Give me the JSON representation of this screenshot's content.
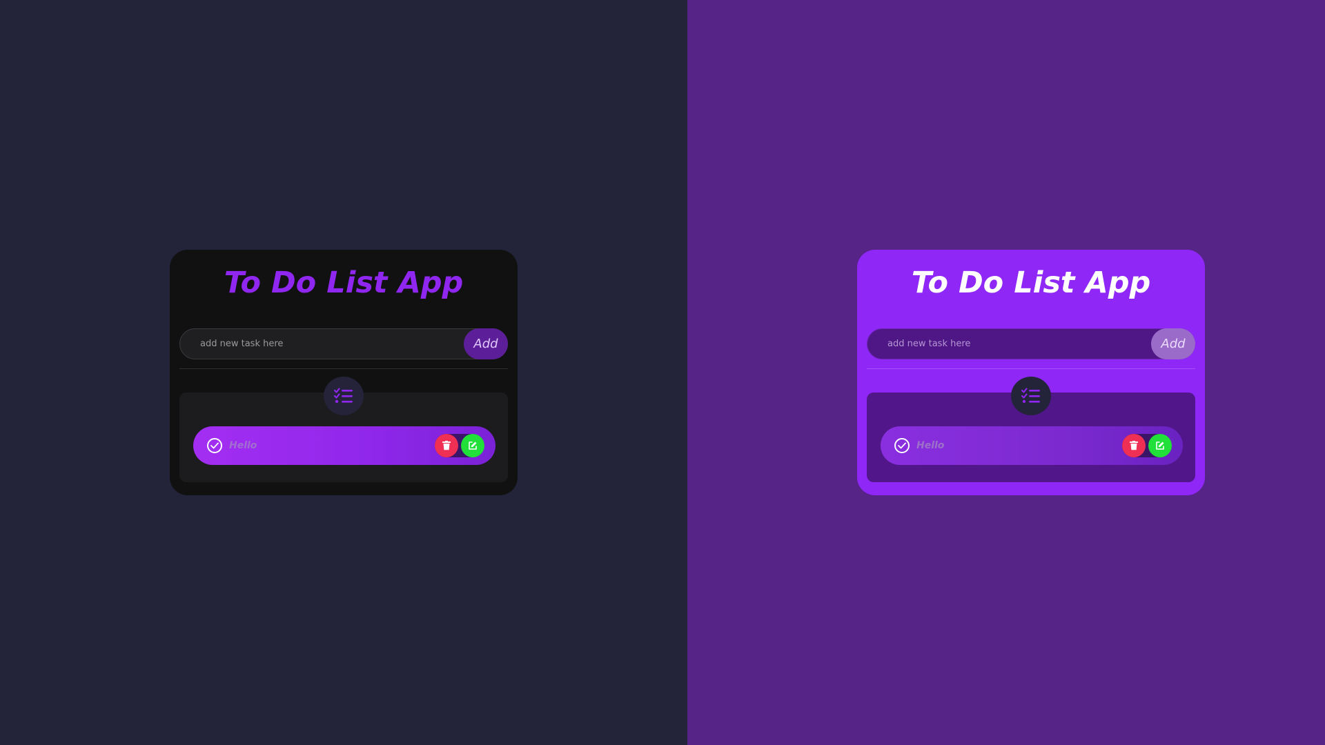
{
  "panels": [
    {
      "theme": "dark",
      "app": {
        "title": "To Do List App",
        "input_placeholder": "add new task here",
        "add_label": "Add",
        "tasks": [
          {
            "text": "Hello"
          }
        ]
      }
    },
    {
      "theme": "light",
      "app": {
        "title": "To Do List App",
        "input_placeholder": "add new task here",
        "add_label": "Add",
        "tasks": [
          {
            "text": "Hello"
          }
        ]
      }
    }
  ],
  "icons": {
    "list": "list-checks-icon",
    "check": "check-circle-icon",
    "delete": "trash-icon",
    "edit": "edit-icon"
  },
  "colors": {
    "dark_background": "#23233a",
    "light_background": "#562387",
    "accent_purple": "#8f27f0",
    "delete_red": "#ef2f54",
    "edit_green": "#22e03a"
  }
}
